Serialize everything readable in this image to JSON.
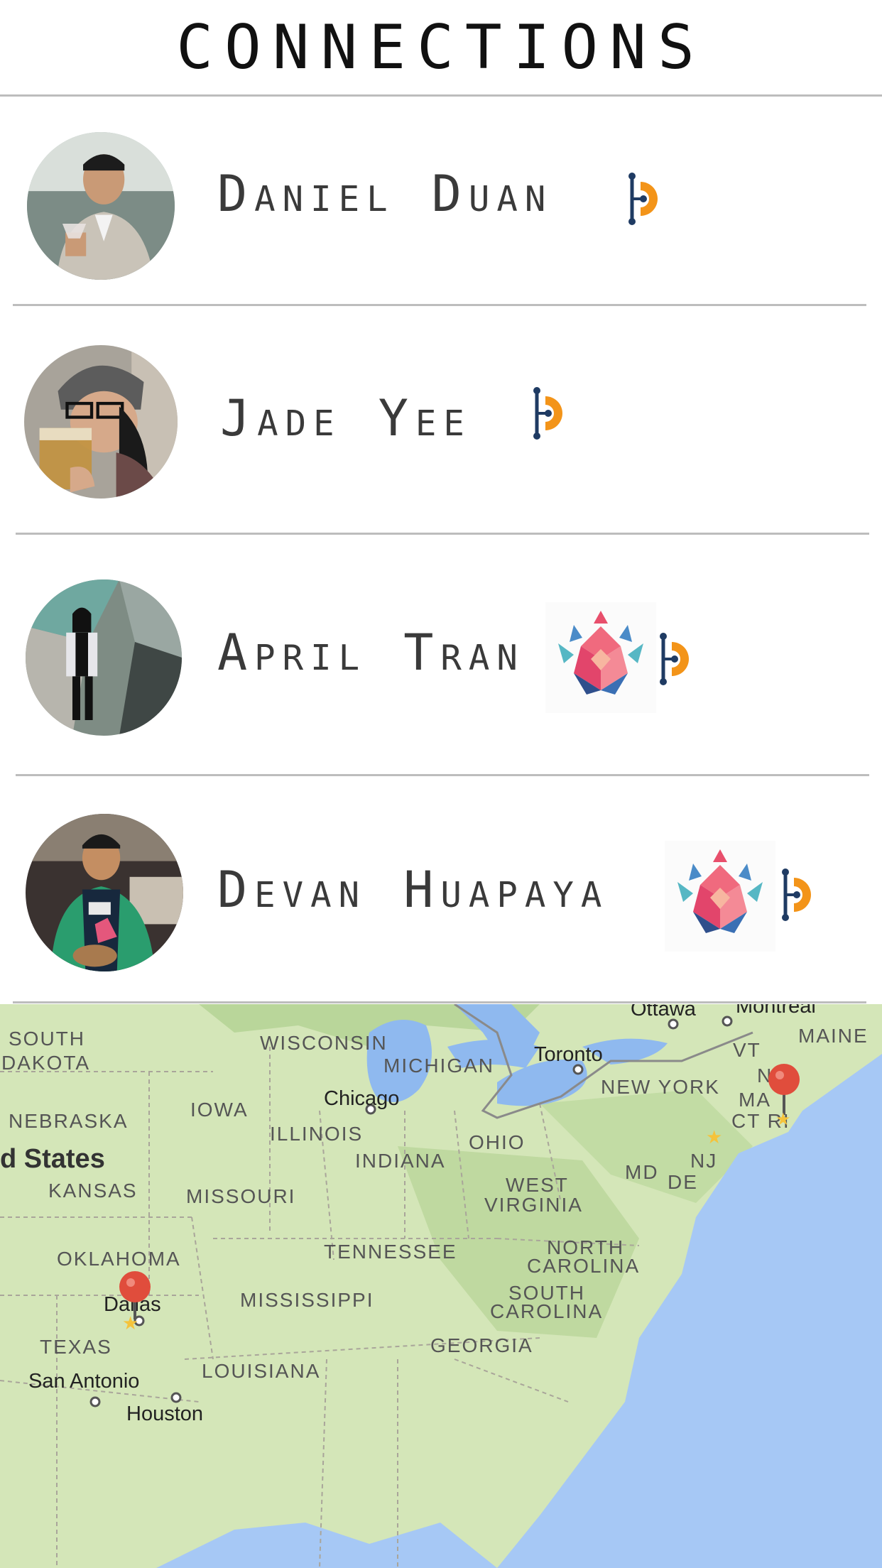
{
  "header": {
    "title": "CONNECTIONS"
  },
  "connections": [
    {
      "name": "Daniel Duan",
      "badges": [
        "hackduke-badge"
      ]
    },
    {
      "name": "Jade Yee",
      "badges": [
        "hackduke-badge"
      ]
    },
    {
      "name": "April Tran",
      "badges": [
        "crown-badge",
        "hackduke-badge"
      ]
    },
    {
      "name": "Devan Huapaya",
      "badges": [
        "crown-badge",
        "hackduke-badge"
      ]
    }
  ],
  "map": {
    "states": {
      "south_dakota": "SOUTH DAKOTA",
      "wisconsin": "WISCONSIN",
      "michigan": "MICHIGAN",
      "iowa": "IOWA",
      "nebraska": "NEBRASKA",
      "illinois": "ILLINOIS",
      "indiana": "INDIANA",
      "ohio": "OHIO",
      "kansas": "KANSAS",
      "missouri": "MISSOURI",
      "west_virginia_1": "WEST",
      "west_virginia_2": "VIRGINIA",
      "oklahoma": "OKLAHOMA",
      "tennessee": "TENNESSEE",
      "north_carolina_1": "NORTH",
      "north_carolina_2": "CAROLINA",
      "south_carolina_1": "SOUTH",
      "south_carolina_2": "CAROLINA",
      "mississippi": "MISSISSIPPI",
      "georgia": "GEORGIA",
      "texas": "TEXAS",
      "louisiana": "LOUISIANA",
      "new_york": "NEW YORK",
      "maine": "MAINE",
      "vt": "VT",
      "nh": "NH",
      "ma": "MA",
      "ct_ri": "CT RI",
      "nj": "NJ",
      "md": "MD",
      "de": "DE",
      "south_dakota_1": "SOUTH",
      "south_dakota_2": "DAKOTA"
    },
    "cities": {
      "chicago": "Chicago",
      "toronto": "Toronto",
      "ottawa": "Ottawa",
      "montreal": "Montreal",
      "dallas": "Dallas",
      "san_antonio": "San Antonio",
      "houston": "Houston"
    },
    "country": "d States",
    "pins": [
      "Boston",
      "Dallas"
    ]
  }
}
